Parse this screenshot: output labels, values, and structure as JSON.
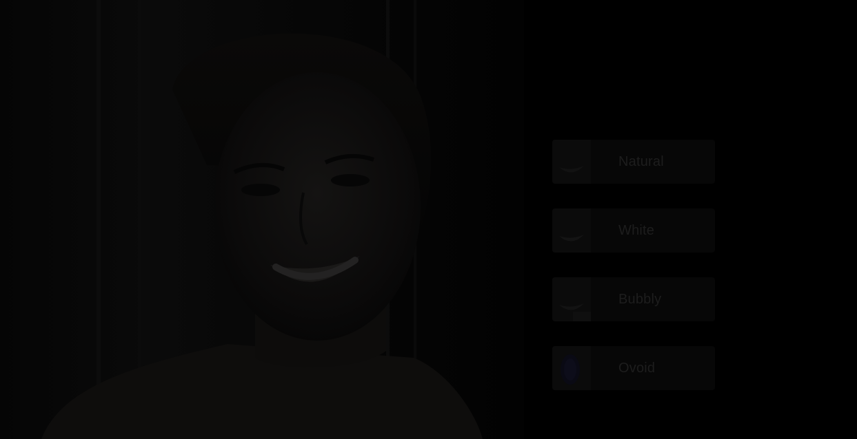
{
  "overlay": {
    "color": "#000000"
  },
  "photo": {
    "subject": "smiling-woman-portrait"
  },
  "options": [
    {
      "label": "Natural",
      "icon": "natural-smile-icon"
    },
    {
      "label": "White",
      "icon": "white-smile-icon"
    },
    {
      "label": "Bubbly",
      "icon": "bubbly-smile-icon"
    },
    {
      "label": "Ovoid",
      "icon": "ovoid-smile-icon"
    }
  ]
}
